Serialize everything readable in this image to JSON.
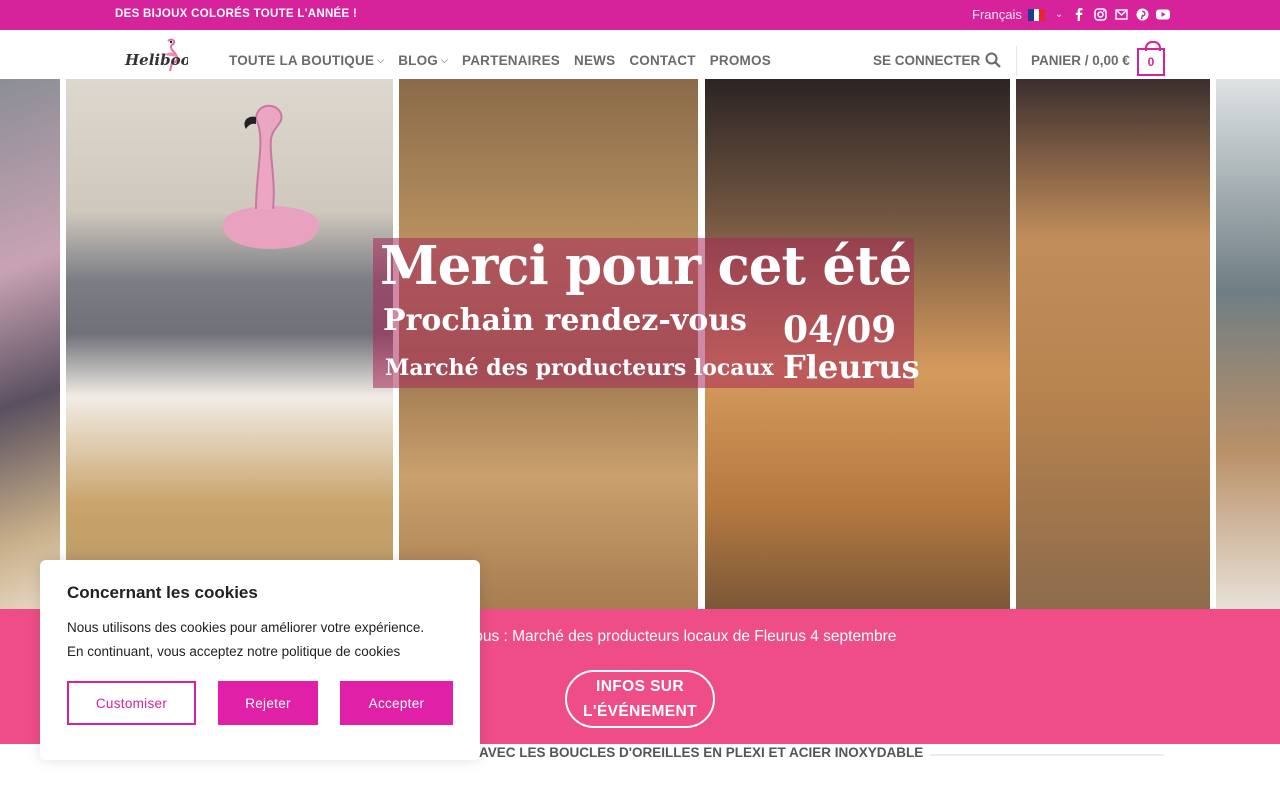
{
  "topbar": {
    "promo": "DES BIJOUX COLORÉS TOUTE L'ANNÉE !",
    "language": "Français",
    "socials": [
      "facebook-icon",
      "instagram-icon",
      "mail-icon",
      "pinterest-icon",
      "youtube-icon"
    ]
  },
  "header": {
    "logo_text": "Heliboo",
    "nav": [
      {
        "label": "TOUTE LA BOUTIQUE",
        "has_dropdown": true
      },
      {
        "label": "BLOG",
        "has_dropdown": true
      },
      {
        "label": "PARTENAIRES",
        "has_dropdown": false
      },
      {
        "label": "NEWS",
        "has_dropdown": false
      },
      {
        "label": "CONTACT",
        "has_dropdown": false
      },
      {
        "label": "PROMOS",
        "has_dropdown": false
      }
    ],
    "login": "SE CONNECTER",
    "cart_label": "PANIER / 0,00 €",
    "cart_count": "0"
  },
  "hero": {
    "title": "Merci pour cet été",
    "subtitle": "Prochain rendez-vous",
    "date": "04/09",
    "event": "Marché des producteurs locaux",
    "city": "Fleurus"
  },
  "band": {
    "text": "z-vous : Marché des producteurs locaux de Fleurus 4 septembre",
    "button_line1": "INFOS SUR",
    "button_line2": "L'ÉVÉNEMENT"
  },
  "section": {
    "title": "R AVEC LES BOUCLES D'OREILLES EN PLEXI ET ACIER INOXYDABLE"
  },
  "cookie": {
    "title": "Concernant les cookies",
    "line1": "Nous utilisons des cookies pour améliorer votre expérience.",
    "line2": "En continuant, vous acceptez notre politique de cookies",
    "customize": "Customiser",
    "reject": "Rejeter",
    "accept": "Accepter"
  },
  "colors": {
    "brand_pink": "#d6239b",
    "band_pink": "#ee4d87",
    "button_pink": "#e020a6"
  }
}
